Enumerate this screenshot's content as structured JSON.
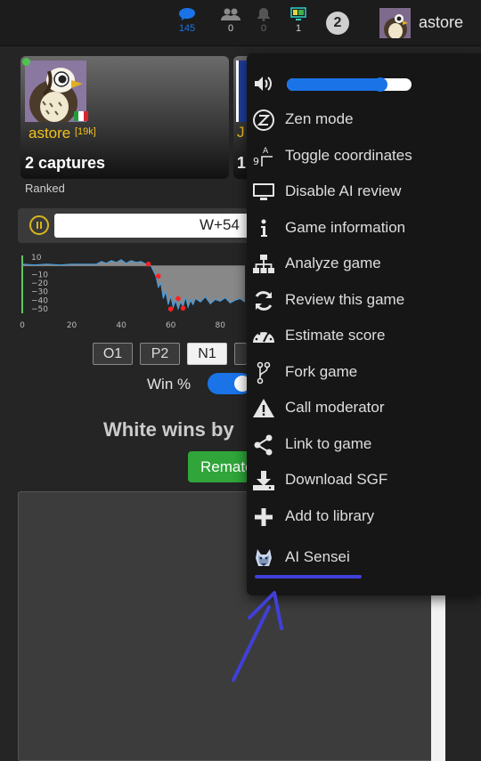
{
  "topbar": {
    "chat_count": "145",
    "friends_count": "0",
    "notifications_count": "0",
    "games_count": "1",
    "badge": "2",
    "username": "astore",
    "colors": {
      "chat": "#1a74e8",
      "games": "#2ec7c0"
    }
  },
  "player": {
    "name": "astore",
    "rank": "[19k]",
    "captures": "2 captures",
    "status": "Ranked",
    "opponent_initial": "J",
    "opponent_captures": "1"
  },
  "score": {
    "text": "W+54"
  },
  "chart_data": {
    "type": "line",
    "yticks": [
      "10",
      "−10",
      "−20",
      "−30",
      "−40",
      "−50"
    ],
    "xticks": [
      "0",
      "20",
      "40",
      "60",
      "80"
    ],
    "xlim": [
      0,
      90
    ],
    "ylim": [
      -55,
      12
    ],
    "series": [
      {
        "x": [
          0,
          5,
          10,
          15,
          20,
          25,
          30,
          32,
          34,
          36,
          38,
          40,
          42,
          44,
          46,
          48,
          50,
          52,
          54,
          55,
          56,
          57,
          58,
          59,
          60,
          61,
          62,
          63,
          64,
          65,
          66,
          67,
          68,
          69,
          70,
          72,
          74,
          76,
          78,
          80,
          82,
          84,
          86,
          88,
          90
        ],
        "y": [
          2,
          1,
          2,
          1,
          2,
          2,
          2,
          5,
          3,
          6,
          4,
          7,
          3,
          6,
          4,
          5,
          2,
          0,
          -12,
          -25,
          -20,
          -38,
          -30,
          -45,
          -35,
          -48,
          -40,
          -50,
          -42,
          -47,
          -36,
          -48,
          -40,
          -45,
          -38,
          -42,
          -36,
          -44,
          -39,
          -41,
          -37,
          -43,
          -40,
          -38,
          -42
        ]
      }
    ],
    "highlight_points": [
      [
        51,
        2
      ],
      [
        55,
        -12
      ],
      [
        60,
        -50
      ],
      [
        63,
        -38
      ],
      [
        65,
        -49
      ]
    ],
    "colors": {
      "line": "#3fa0e8",
      "fill": "#9a9a9a",
      "marker": "#ff2020",
      "axis": "#5fc85f"
    }
  },
  "moves": {
    "o1": "O1",
    "p2": "P2",
    "n1": "N1"
  },
  "winrate": {
    "label": "Win %"
  },
  "result": {
    "text": "White wins by"
  },
  "rematch": {
    "label": "Rematch"
  },
  "menu": {
    "volume_fraction": 0.75,
    "items": [
      {
        "label": "Zen mode",
        "icon": "zen-icon"
      },
      {
        "label": "Toggle coordinates",
        "icon": "coordinates-icon"
      },
      {
        "label": "Disable AI review",
        "icon": "monitor-icon"
      },
      {
        "label": "Game information",
        "icon": "info-icon"
      },
      {
        "label": "Analyze game",
        "icon": "sitemap-icon"
      },
      {
        "label": "Review this game",
        "icon": "refresh-icon"
      },
      {
        "label": "Estimate score",
        "icon": "gauge-icon"
      },
      {
        "label": "Fork game",
        "icon": "fork-icon"
      },
      {
        "label": "Call moderator",
        "icon": "warning-icon"
      },
      {
        "label": "Link to game",
        "icon": "share-icon"
      },
      {
        "label": "Download SGF",
        "icon": "download-icon"
      },
      {
        "label": "Add to library",
        "icon": "plus-icon"
      },
      {
        "label": "AI Sensei",
        "icon": "ai-sensei-icon"
      }
    ],
    "annotation_color": "#4040d8"
  }
}
